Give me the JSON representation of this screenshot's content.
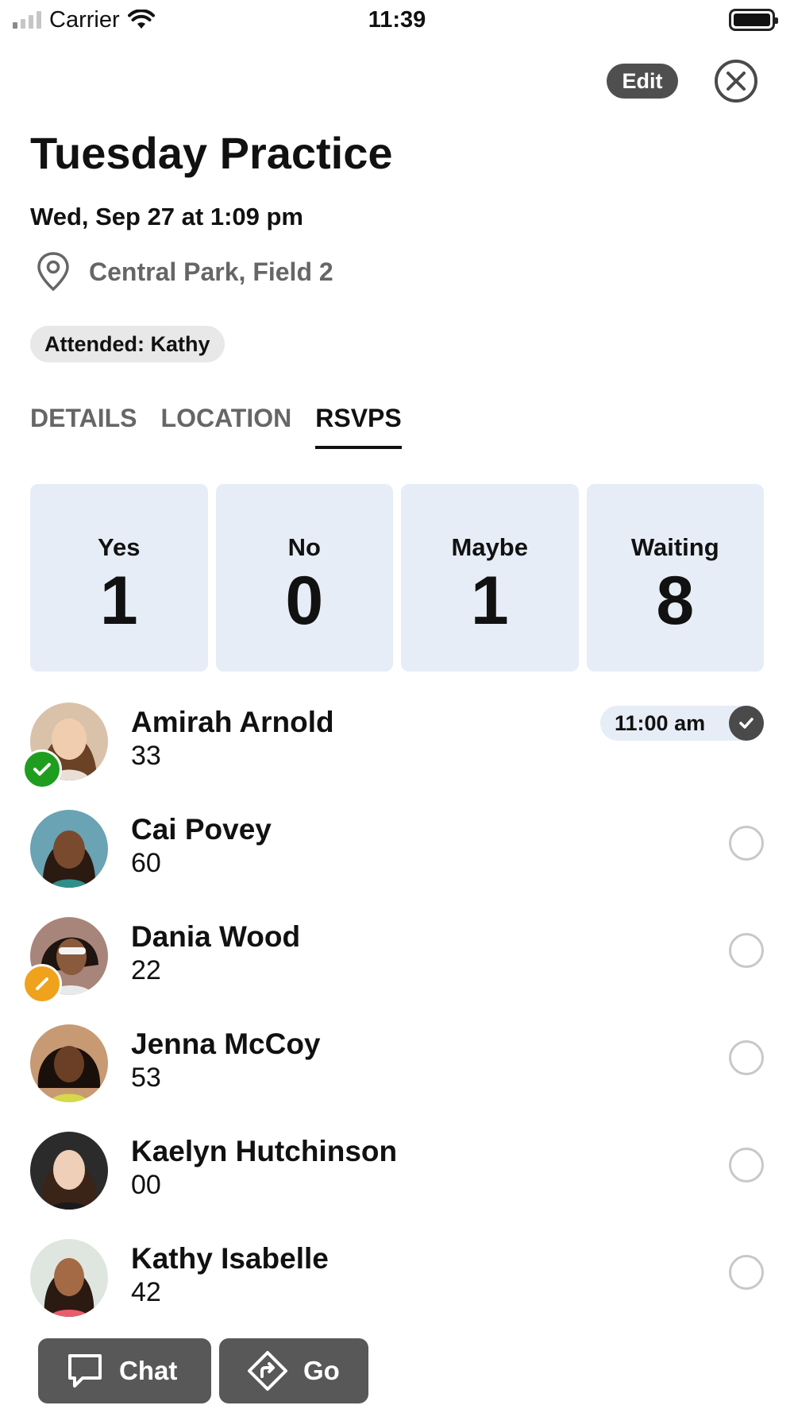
{
  "status_bar": {
    "carrier": "Carrier",
    "time": "11:39"
  },
  "header": {
    "edit_label": "Edit"
  },
  "event": {
    "title": "Tuesday Practice",
    "date": "Wed, Sep 27 at 1:09 pm",
    "location": "Central Park, Field 2",
    "attended": "Attended: Kathy"
  },
  "tabs": [
    {
      "label": "DETAILS",
      "active": false
    },
    {
      "label": "LOCATION",
      "active": false
    },
    {
      "label": "RSVPS",
      "active": true
    }
  ],
  "stats": [
    {
      "label": "Yes",
      "value": "1"
    },
    {
      "label": "No",
      "value": "0"
    },
    {
      "label": "Maybe",
      "value": "1"
    },
    {
      "label": "Waiting",
      "value": "8"
    }
  ],
  "members": [
    {
      "name": "Amirah Arnold",
      "number": "33",
      "status": "yes",
      "check_in": "11:00 am",
      "checked": true
    },
    {
      "name": "Cai Povey",
      "number": "60",
      "status": "none",
      "checked": false
    },
    {
      "name": "Dania Wood",
      "number": "22",
      "status": "maybe",
      "checked": false
    },
    {
      "name": "Jenna McCoy",
      "number": "53",
      "status": "none",
      "checked": false
    },
    {
      "name": "Kaelyn Hutchinson",
      "number": "00",
      "status": "none",
      "checked": false
    },
    {
      "name": "Kathy Isabelle",
      "number": "42",
      "status": "none",
      "checked": false
    }
  ],
  "actions": {
    "chat_label": "Chat",
    "go_label": "Go"
  },
  "colors": {
    "yes": "#1f9d1f",
    "maybe": "#f0a21c",
    "card_bg": "#e6edf6",
    "button_bg": "#585858"
  }
}
